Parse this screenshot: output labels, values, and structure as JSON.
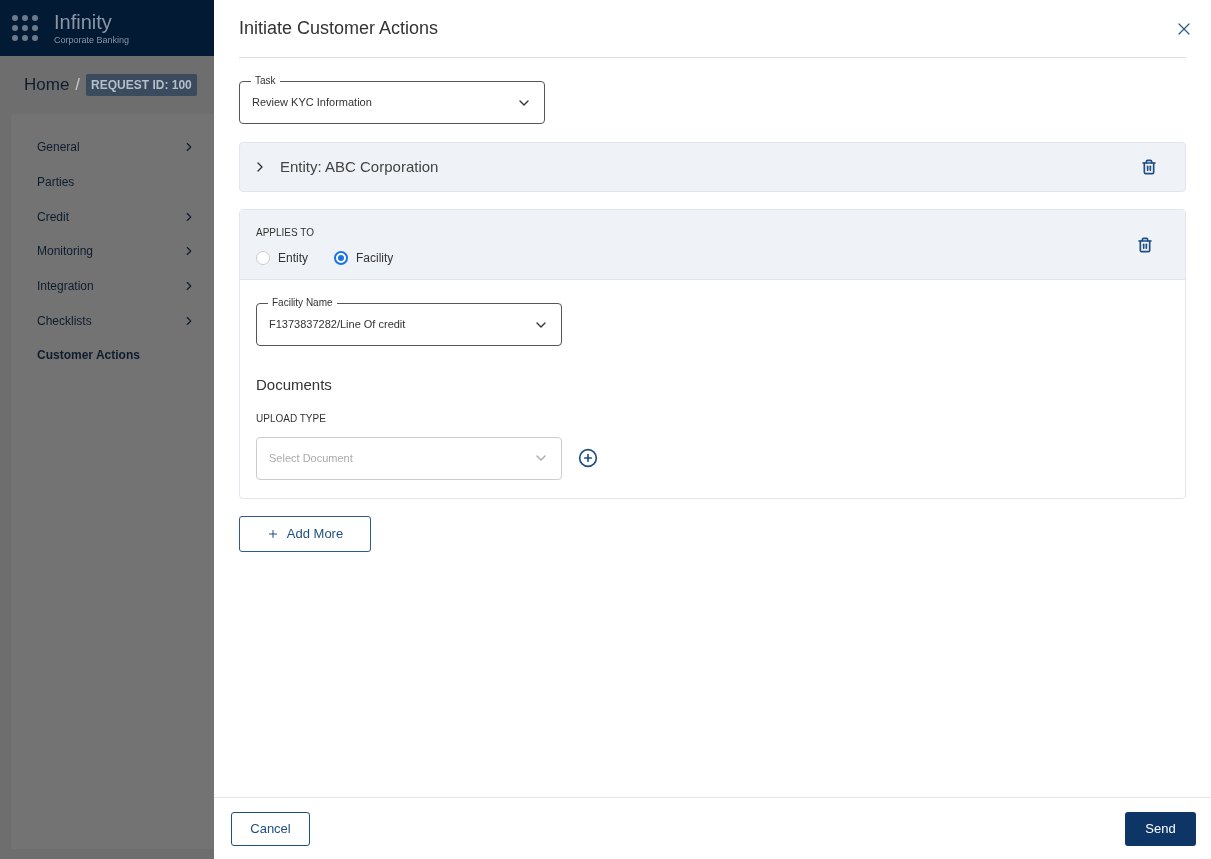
{
  "app": {
    "brand": "Infinity",
    "subtitle": "Corporate Banking"
  },
  "breadcrumb": {
    "home": "Home",
    "separator": "/",
    "request_id": "REQUEST ID: 100"
  },
  "sidebar": {
    "items": [
      {
        "label": "General",
        "expandable": true,
        "selected": false
      },
      {
        "label": "Parties",
        "expandable": false,
        "selected": false
      },
      {
        "label": "Credit",
        "expandable": true,
        "selected": false
      },
      {
        "label": "Monitoring",
        "expandable": true,
        "selected": false
      },
      {
        "label": "Integration",
        "expandable": true,
        "selected": false
      },
      {
        "label": "Checklists",
        "expandable": true,
        "selected": false
      },
      {
        "label": "Customer Actions",
        "expandable": false,
        "selected": true
      }
    ]
  },
  "dialog": {
    "title": "Initiate Customer Actions",
    "task": {
      "label": "Task",
      "value": "Review KYC Information"
    },
    "entity_panel": {
      "title": "Entity: ABC Corporation",
      "expanded": false
    },
    "applies_panel": {
      "label": "APPLIES TO",
      "options": [
        {
          "label": "Entity",
          "selected": false
        },
        {
          "label": "Facility",
          "selected": true
        }
      ],
      "facility": {
        "label": "Facility Name",
        "value": "F1373837282/Line Of credit"
      },
      "documents_heading": "Documents",
      "upload_label": "UPLOAD TYPE",
      "upload": {
        "placeholder": "Select Document"
      }
    },
    "add_more": "Add More",
    "cancel": "Cancel",
    "send": "Send"
  }
}
